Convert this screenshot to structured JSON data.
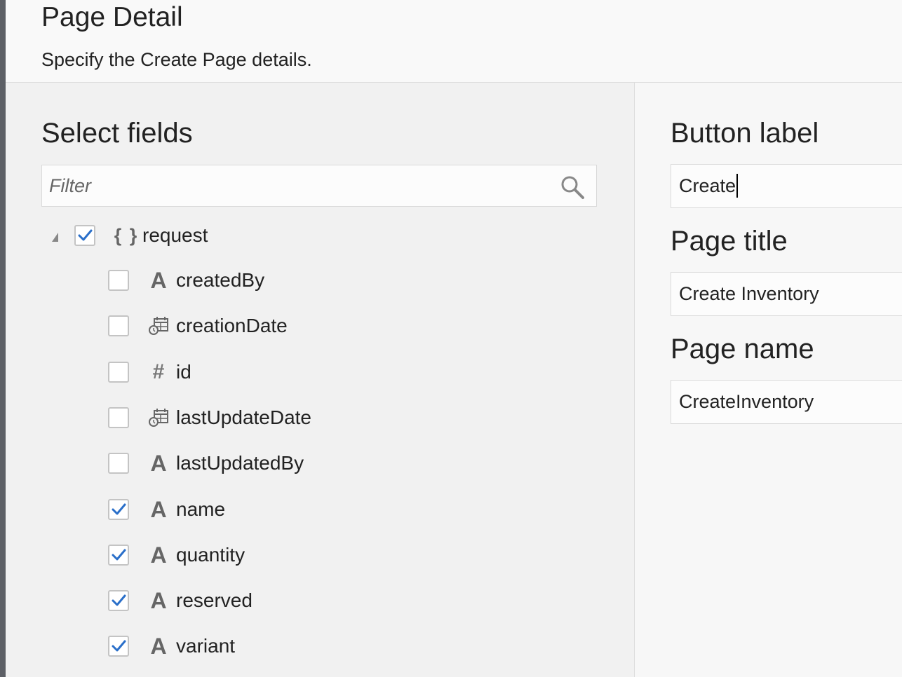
{
  "header": {
    "title": "Page Detail",
    "subtitle": "Specify the Create Page details."
  },
  "fields_panel": {
    "heading": "Select fields",
    "filter_placeholder": "Filter",
    "root": {
      "label": "request",
      "icon": "object-braces-icon",
      "checked": true,
      "expanded": true
    },
    "items": [
      {
        "label": "createdBy",
        "icon": "text-type-icon",
        "checked": false
      },
      {
        "label": "creationDate",
        "icon": "datetime-type-icon",
        "checked": false
      },
      {
        "label": "id",
        "icon": "number-type-icon",
        "checked": false
      },
      {
        "label": "lastUpdateDate",
        "icon": "datetime-type-icon",
        "checked": false
      },
      {
        "label": "lastUpdatedBy",
        "icon": "text-type-icon",
        "checked": false
      },
      {
        "label": "name",
        "icon": "text-type-icon",
        "checked": true
      },
      {
        "label": "quantity",
        "icon": "text-type-icon",
        "checked": true
      },
      {
        "label": "reserved",
        "icon": "text-type-icon",
        "checked": true
      },
      {
        "label": "variant",
        "icon": "text-type-icon",
        "checked": true
      }
    ]
  },
  "settings_panel": {
    "button_label": {
      "heading": "Button label",
      "value": "Create"
    },
    "page_title": {
      "heading": "Page title",
      "value": "Create Inventory"
    },
    "page_name": {
      "heading": "Page name",
      "value": "CreateInventory"
    }
  },
  "colors": {
    "checkmark": "#2a6fc9",
    "icon_gray": "#666666"
  }
}
